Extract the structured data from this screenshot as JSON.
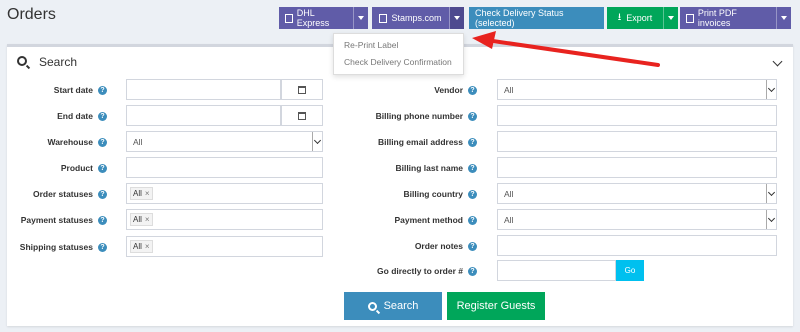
{
  "page": {
    "title": "Orders"
  },
  "toolbar": {
    "dhl_label": "DHL Express",
    "stamps_label": "Stamps.com",
    "check_delivery_label": "Check Delivery Status (selected)",
    "export_label": "Export",
    "print_pdf_label": "Print PDF invoices"
  },
  "dropdown": {
    "items": [
      "Re-Print Label",
      "Check Delivery Confirmation"
    ]
  },
  "search": {
    "title": "Search",
    "left_fields": [
      {
        "label": "Start date",
        "value": ""
      },
      {
        "label": "End date",
        "value": ""
      },
      {
        "label": "Warehouse",
        "value": "All"
      },
      {
        "label": "Product",
        "value": ""
      },
      {
        "label": "Order statuses",
        "value": "All"
      },
      {
        "label": "Payment statuses",
        "value": "All"
      },
      {
        "label": "Shipping statuses",
        "value": "All"
      }
    ],
    "right_fields": [
      {
        "label": "Vendor",
        "value": "All"
      },
      {
        "label": "Billing phone number",
        "value": ""
      },
      {
        "label": "Billing email address",
        "value": ""
      },
      {
        "label": "Billing last name",
        "value": ""
      },
      {
        "label": "Billing country",
        "value": "All"
      },
      {
        "label": "Payment method",
        "value": "All"
      },
      {
        "label": "Order notes",
        "value": ""
      },
      {
        "label": "Go directly to order #",
        "value": ""
      }
    ],
    "go_label": "Go",
    "search_button": "Search",
    "register_button": "Register Guests"
  },
  "colors": {
    "purple": "#605ca8",
    "blue": "#3c8dbc",
    "green": "#00a65a",
    "cyan": "#00c0ef",
    "arrow": "#e8231f"
  }
}
